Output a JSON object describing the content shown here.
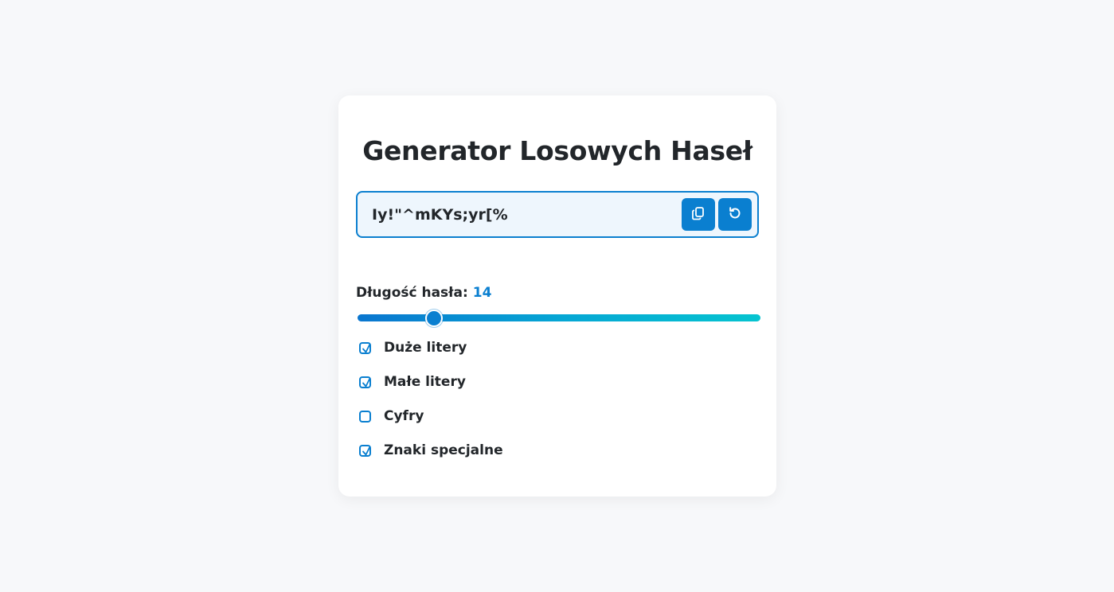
{
  "title": "Generator Losowych Haseł",
  "password": "Iy!\"^mKYs;yr[%",
  "buttons": {
    "copy_icon": "copy-icon",
    "refresh_icon": "refresh-icon"
  },
  "length": {
    "label": "Długość hasła:",
    "value": "14",
    "slider_fraction": 0.19
  },
  "options": [
    {
      "label": "Duże litery",
      "checked": true
    },
    {
      "label": "Małe litery",
      "checked": true
    },
    {
      "label": "Cyfry",
      "checked": false
    },
    {
      "label": "Znaki specjalne",
      "checked": true
    }
  ],
  "colors": {
    "accent": "#0a7fd0",
    "background": "#f7f8fa",
    "card": "#ffffff"
  }
}
